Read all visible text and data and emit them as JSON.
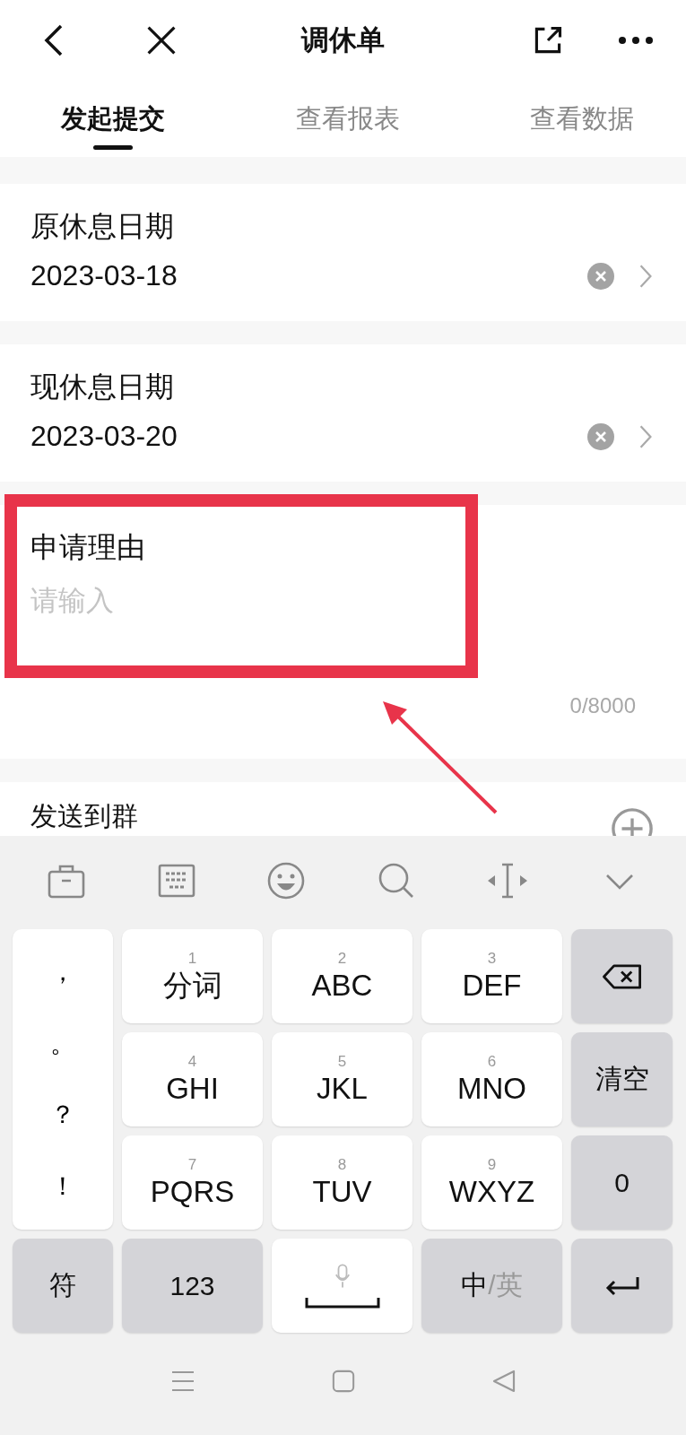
{
  "header": {
    "title": "调休单"
  },
  "tabs": [
    {
      "label": "发起提交",
      "selected": true
    },
    {
      "label": "查看报表",
      "selected": false
    },
    {
      "label": "查看数据",
      "selected": false
    }
  ],
  "fields": [
    {
      "label": "原休息日期",
      "value": "2023-03-18"
    },
    {
      "label": "现休息日期",
      "value": "2023-03-20"
    }
  ],
  "reason": {
    "label": "申请理由",
    "placeholder": "请输入",
    "counter": "0/8000"
  },
  "send_to_group": {
    "label": "发送到群"
  },
  "keyboard": {
    "punctuation": [
      "，",
      "。",
      "？",
      "！"
    ],
    "keys": [
      {
        "digit": "1",
        "label": "分词"
      },
      {
        "digit": "2",
        "label": "ABC"
      },
      {
        "digit": "3",
        "label": "DEF"
      },
      {
        "digit": "4",
        "label": "GHI"
      },
      {
        "digit": "5",
        "label": "JKL"
      },
      {
        "digit": "6",
        "label": "MNO"
      },
      {
        "digit": "7",
        "label": "PQRS"
      },
      {
        "digit": "8",
        "label": "TUV"
      },
      {
        "digit": "9",
        "label": "WXYZ"
      }
    ],
    "clear": "清空",
    "zero": "0",
    "symbols": "符",
    "numbers": "123",
    "language": {
      "label": "中",
      "alt": "/英"
    }
  }
}
